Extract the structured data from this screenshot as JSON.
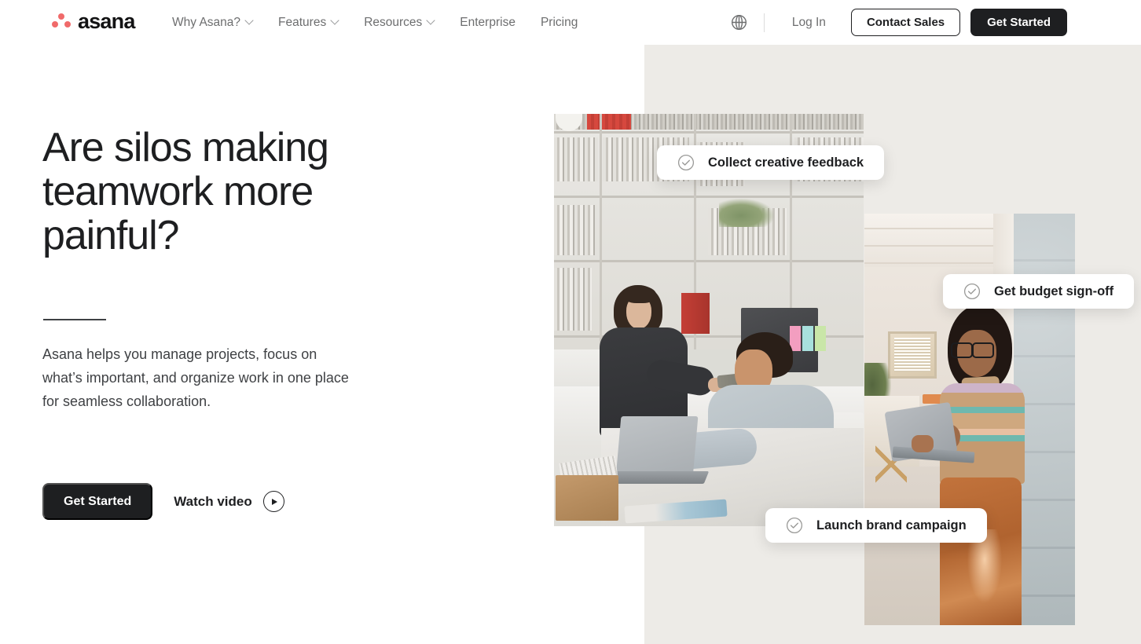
{
  "brand": {
    "name": "asana",
    "logo_dot_color": "#f06a6a",
    "logo_icon": "asana-three-dots-logo"
  },
  "header": {
    "nav_items": [
      {
        "label": "Why Asana?",
        "has_dropdown": true,
        "icon": "chevron-down-icon"
      },
      {
        "label": "Features",
        "has_dropdown": true,
        "icon": "chevron-down-icon"
      },
      {
        "label": "Resources",
        "has_dropdown": true,
        "icon": "chevron-down-icon"
      },
      {
        "label": "Enterprise",
        "has_dropdown": false,
        "icon": ""
      },
      {
        "label": "Pricing",
        "has_dropdown": false,
        "icon": ""
      }
    ],
    "language_icon": "globe-icon",
    "login_label": "Log In",
    "contact_sales_label": "Contact Sales",
    "get_started_label": "Get Started"
  },
  "hero": {
    "title": "Are silos making teamwork more painful?",
    "subtitle": "Asana helps you manage projects, focus on what’s important, and organize work in one place for seamless collaboration.",
    "primary_cta": "Get Started",
    "secondary_cta": "Watch video",
    "play_icon": "play-circle-icon"
  },
  "task_cards": [
    {
      "label": "Collect creative feedback",
      "icon": "check-circle-icon"
    },
    {
      "label": "Get budget sign-off",
      "icon": "check-circle-icon"
    },
    {
      "label": "Launch brand campaign",
      "icon": "check-circle-icon"
    }
  ],
  "media": {
    "left_photo_alt": "Two coworkers collaborating at a white desk in a studio office with bookshelves",
    "right_photo_alt": "Woman with glasses holding a laptop while leaning on a concrete pillar"
  },
  "colors": {
    "accent": "#f06a6a",
    "dark": "#1e1f21",
    "panel_beige": "#edebe7",
    "muted_text": "#6d6e6f",
    "body_text": "#3f4144"
  }
}
